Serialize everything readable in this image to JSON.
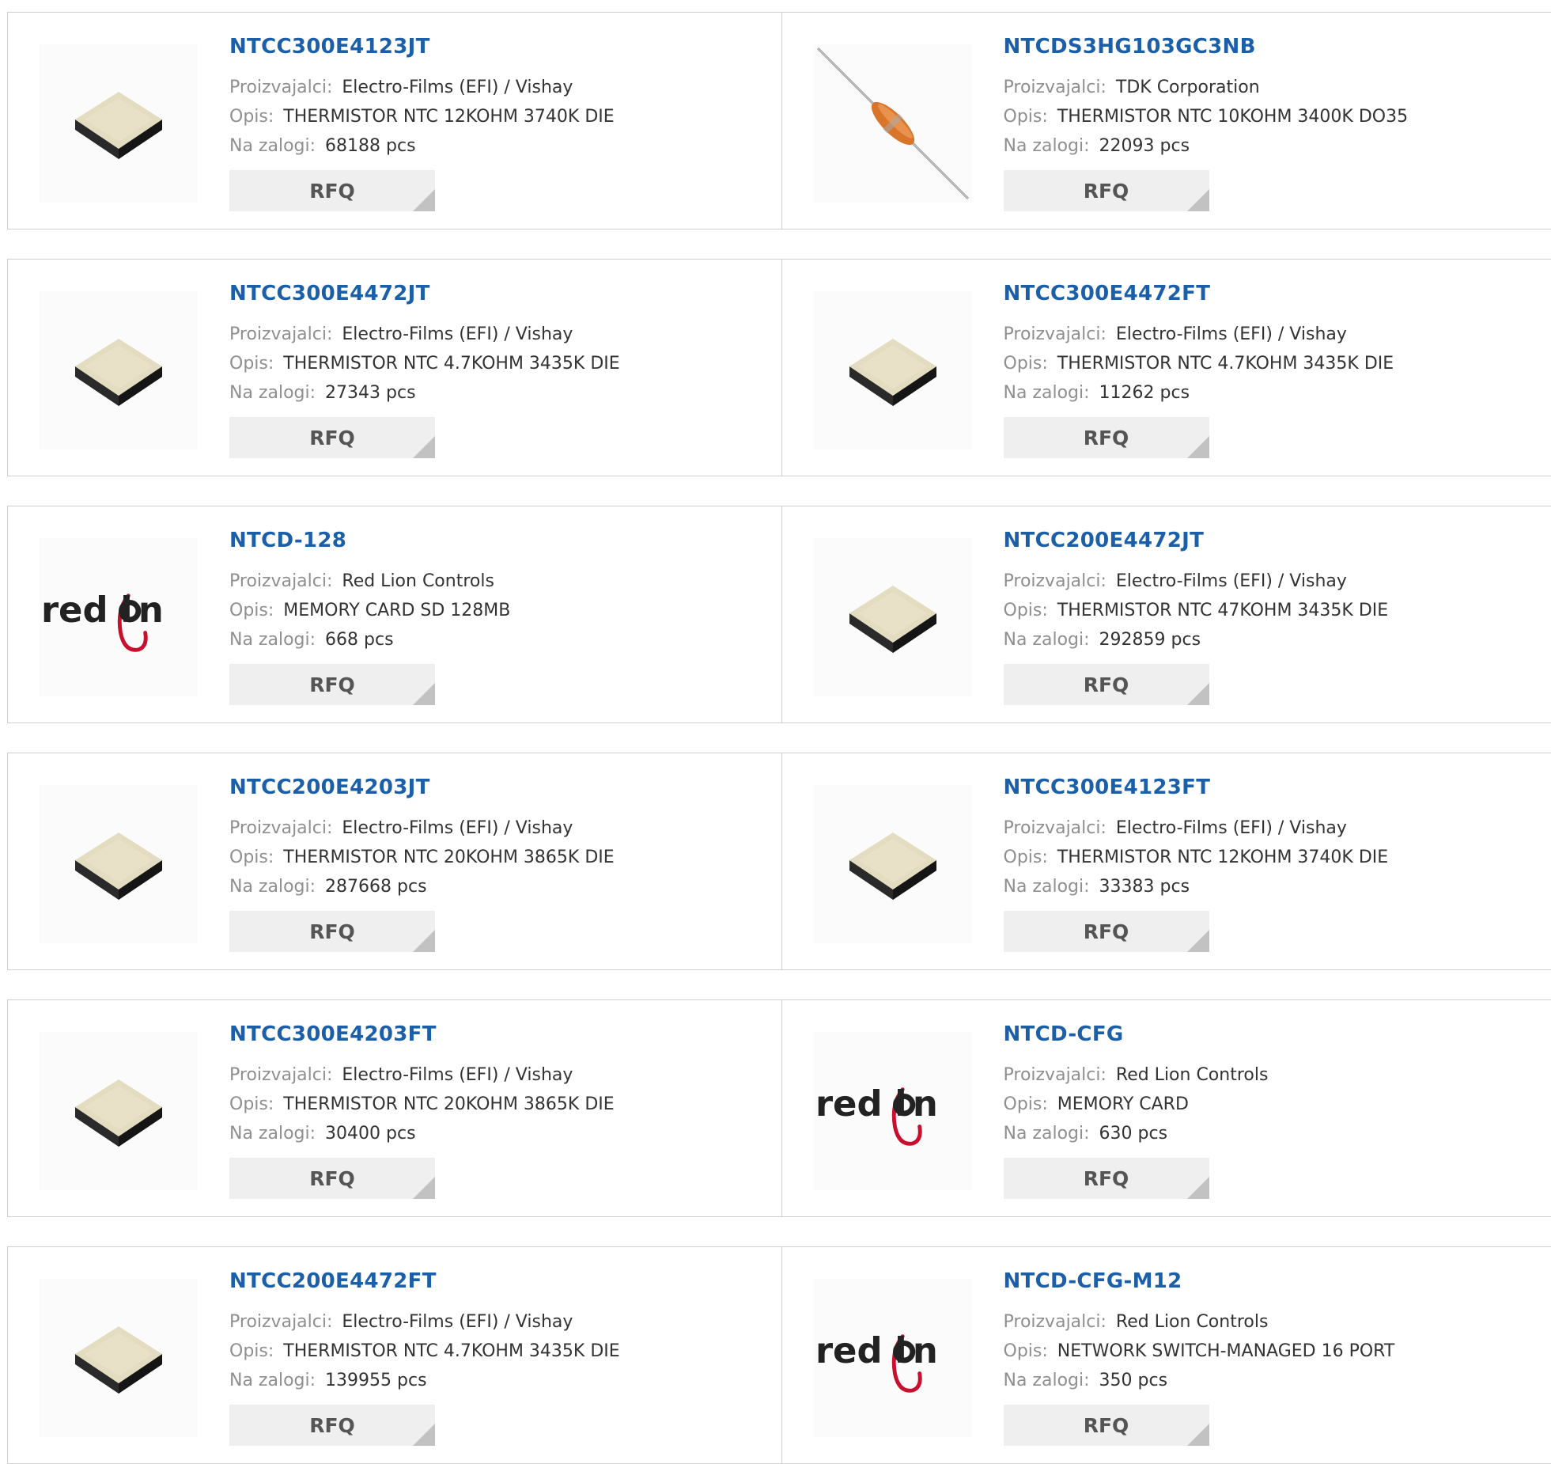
{
  "labels": {
    "manufacturer": "Proizvajalci:",
    "description": "Opis:",
    "stock": "Na zalogi:",
    "rfq": "RFQ"
  },
  "colors": {
    "part_link": "#1a5fa8",
    "label_text": "#8f8f8f",
    "rfq_button_bg": "#efefef",
    "redlion_red": "#c8102e"
  },
  "products": [
    {
      "part": "NTCC300E4123JT",
      "manufacturer": "Electro-Films (EFI) / Vishay",
      "description": "THERMISTOR NTC 12KOHM 3740K DIE",
      "stock": "68188 pcs",
      "image": "die-chip"
    },
    {
      "part": "NTCDS3HG103GC3NB",
      "manufacturer": "TDK Corporation",
      "description": "THERMISTOR NTC 10KOHM 3400K DO35",
      "stock": "22093 pcs",
      "image": "axial-thermistor"
    },
    {
      "part": "NTCC300E4472JT",
      "manufacturer": "Electro-Films (EFI) / Vishay",
      "description": "THERMISTOR NTC 4.7KOHM 3435K DIE",
      "stock": "27343 pcs",
      "image": "die-chip"
    },
    {
      "part": "NTCC300E4472FT",
      "manufacturer": "Electro-Films (EFI) / Vishay",
      "description": "THERMISTOR NTC 4.7KOHM 3435K DIE",
      "stock": "11262 pcs",
      "image": "die-chip"
    },
    {
      "part": "NTCD-128",
      "manufacturer": "Red Lion Controls",
      "description": "MEMORY CARD SD 128MB",
      "stock": "668 pcs",
      "image": "red-lion-logo"
    },
    {
      "part": "NTCC200E4472JT",
      "manufacturer": "Electro-Films (EFI) / Vishay",
      "description": "THERMISTOR NTC 47KOHM 3435K DIE",
      "stock": "292859 pcs",
      "image": "die-chip"
    },
    {
      "part": "NTCC200E4203JT",
      "manufacturer": "Electro-Films (EFI) / Vishay",
      "description": "THERMISTOR NTC 20KOHM 3865K DIE",
      "stock": "287668 pcs",
      "image": "die-chip"
    },
    {
      "part": "NTCC300E4123FT",
      "manufacturer": "Electro-Films (EFI) / Vishay",
      "description": "THERMISTOR NTC 12KOHM 3740K DIE",
      "stock": "33383 pcs",
      "image": "die-chip"
    },
    {
      "part": "NTCC300E4203FT",
      "manufacturer": "Electro-Films (EFI) / Vishay",
      "description": "THERMISTOR NTC 20KOHM 3865K DIE",
      "stock": "30400 pcs",
      "image": "die-chip"
    },
    {
      "part": "NTCD-CFG",
      "manufacturer": "Red Lion Controls",
      "description": "MEMORY CARD",
      "stock": "630 pcs",
      "image": "red-lion-logo"
    },
    {
      "part": "NTCC200E4472FT",
      "manufacturer": "Electro-Films (EFI) / Vishay",
      "description": "THERMISTOR NTC 4.7KOHM 3435K DIE",
      "stock": "139955 pcs",
      "image": "die-chip"
    },
    {
      "part": "NTCD-CFG-M12",
      "manufacturer": "Red Lion Controls",
      "description": "NETWORK SWITCH-MANAGED 16 PORT",
      "stock": "350 pcs",
      "image": "red-lion-logo"
    }
  ]
}
